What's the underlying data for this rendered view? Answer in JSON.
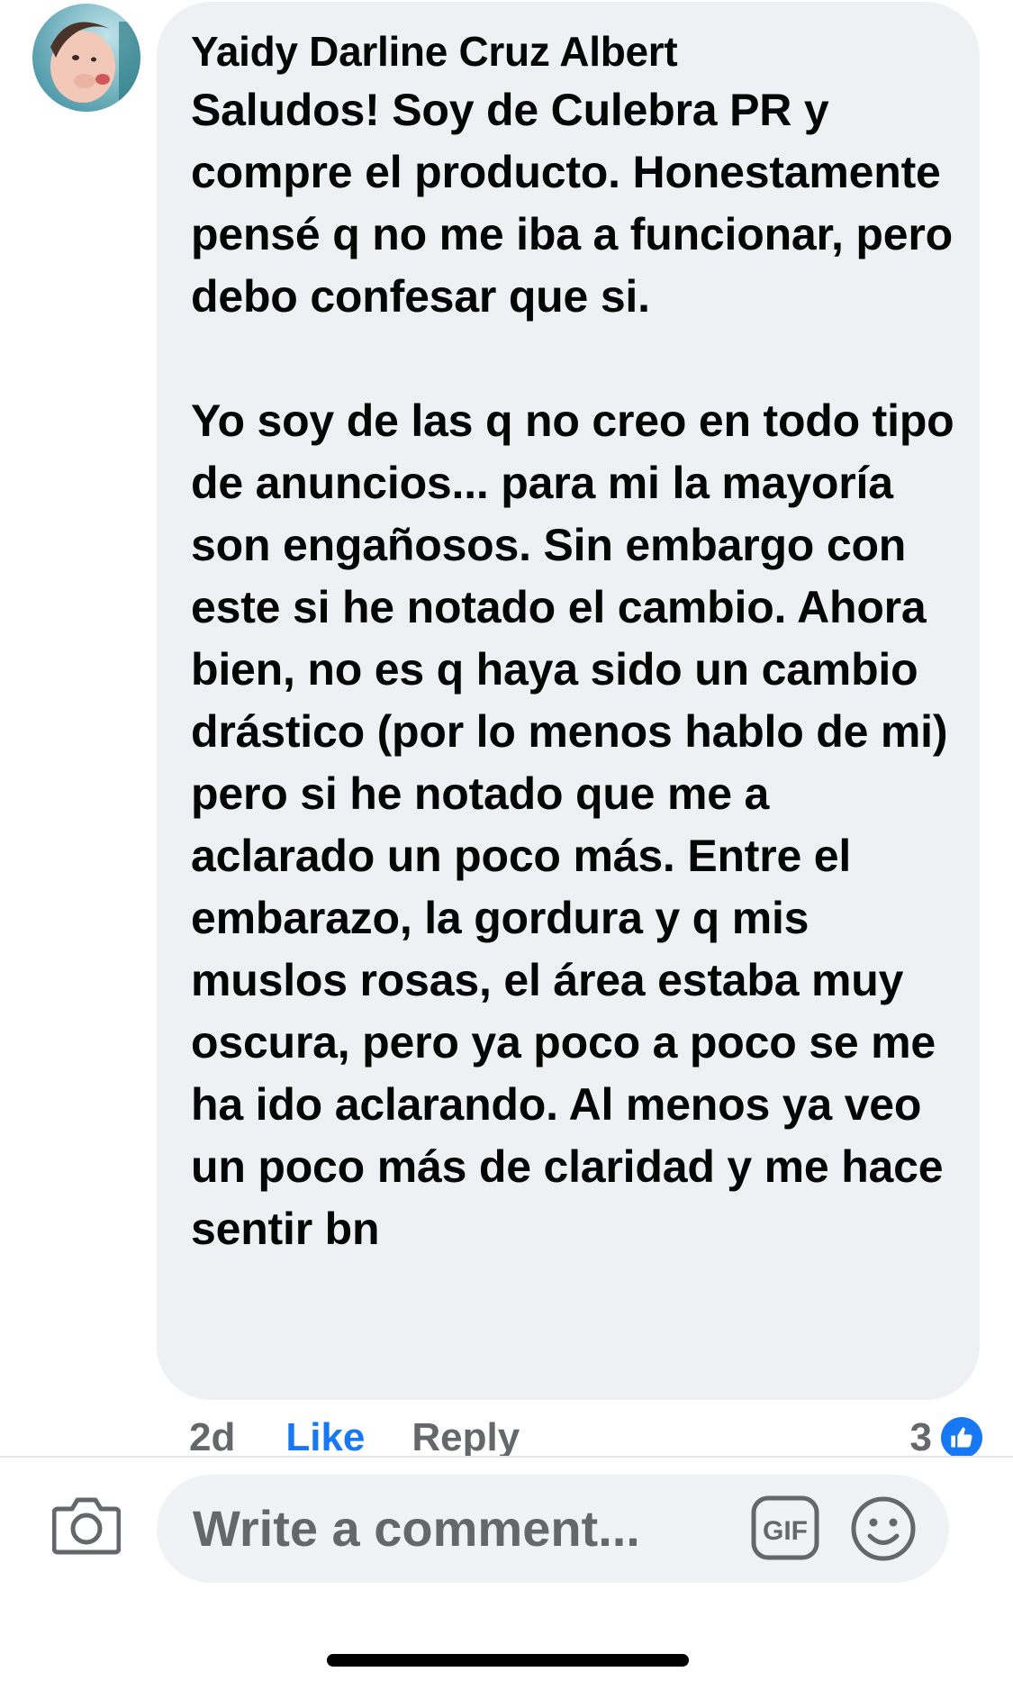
{
  "comment": {
    "author": "Yaidy Darline Cruz Albert",
    "avatar_icon": "profile-photo-baby",
    "paragraph_1": "Saludos! Soy de Culebra PR y compre el producto. Honestamente pensé q no me iba a funcionar, pero debo confesar que si.",
    "paragraph_2": "Yo soy de las q no creo en todo tipo de anuncios... para mi la mayoría son engañosos. Sin embargo con este si he notado el cambio. Ahora bien, no es q haya sido un cambio drástico (por lo menos hablo de mi) pero si he notado que me a aclarado un poco más. Entre el embarazo, la gordura y q mis muslos rosas, el área estaba muy oscura, pero ya poco a poco se me ha ido aclarando. Al menos ya veo un poco más de claridad y me hace sentir bn"
  },
  "actions": {
    "time": "2d",
    "like_label": "Like",
    "reply_label": "Reply",
    "reaction_count": "3",
    "reaction_icon": "thumbs-up-icon"
  },
  "composer": {
    "placeholder": "Write a comment...",
    "camera_icon": "camera-icon",
    "gif_label": "GIF",
    "emoji_icon": "smiley-icon"
  },
  "colors": {
    "bubble": "#eff0f3",
    "text": "#050505",
    "secondary": "#65676b",
    "accent": "#1877f2"
  }
}
